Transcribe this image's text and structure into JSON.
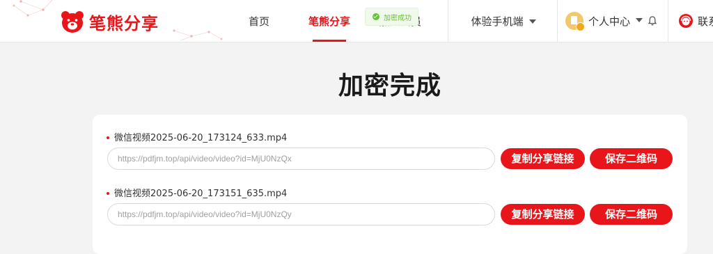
{
  "brand": {
    "name": "笔熊分享",
    "color": "#e8161b"
  },
  "nav": {
    "home": "首页",
    "share": "笔熊分享",
    "vip": "加入会员",
    "mobile": "体验手机端",
    "user_center": "个人中心",
    "contact": "联系"
  },
  "toast": {
    "text": "加密成功",
    "icon": "check-circle-icon"
  },
  "page": {
    "title": "加密完成"
  },
  "files": [
    {
      "name": "微信视频2025-06-20_173124_633.mp4",
      "link": "https://pdfjm.top/api/video/video?id=MjU0NzQx",
      "copy_label": "复制分享链接",
      "qr_label": "保存二维码"
    },
    {
      "name": "微信视频2025-06-20_173151_635.mp4",
      "link": "https://pdfjm.top/api/video/video?id=MjU0NzQy",
      "copy_label": "复制分享链接",
      "qr_label": "保存二维码"
    }
  ]
}
